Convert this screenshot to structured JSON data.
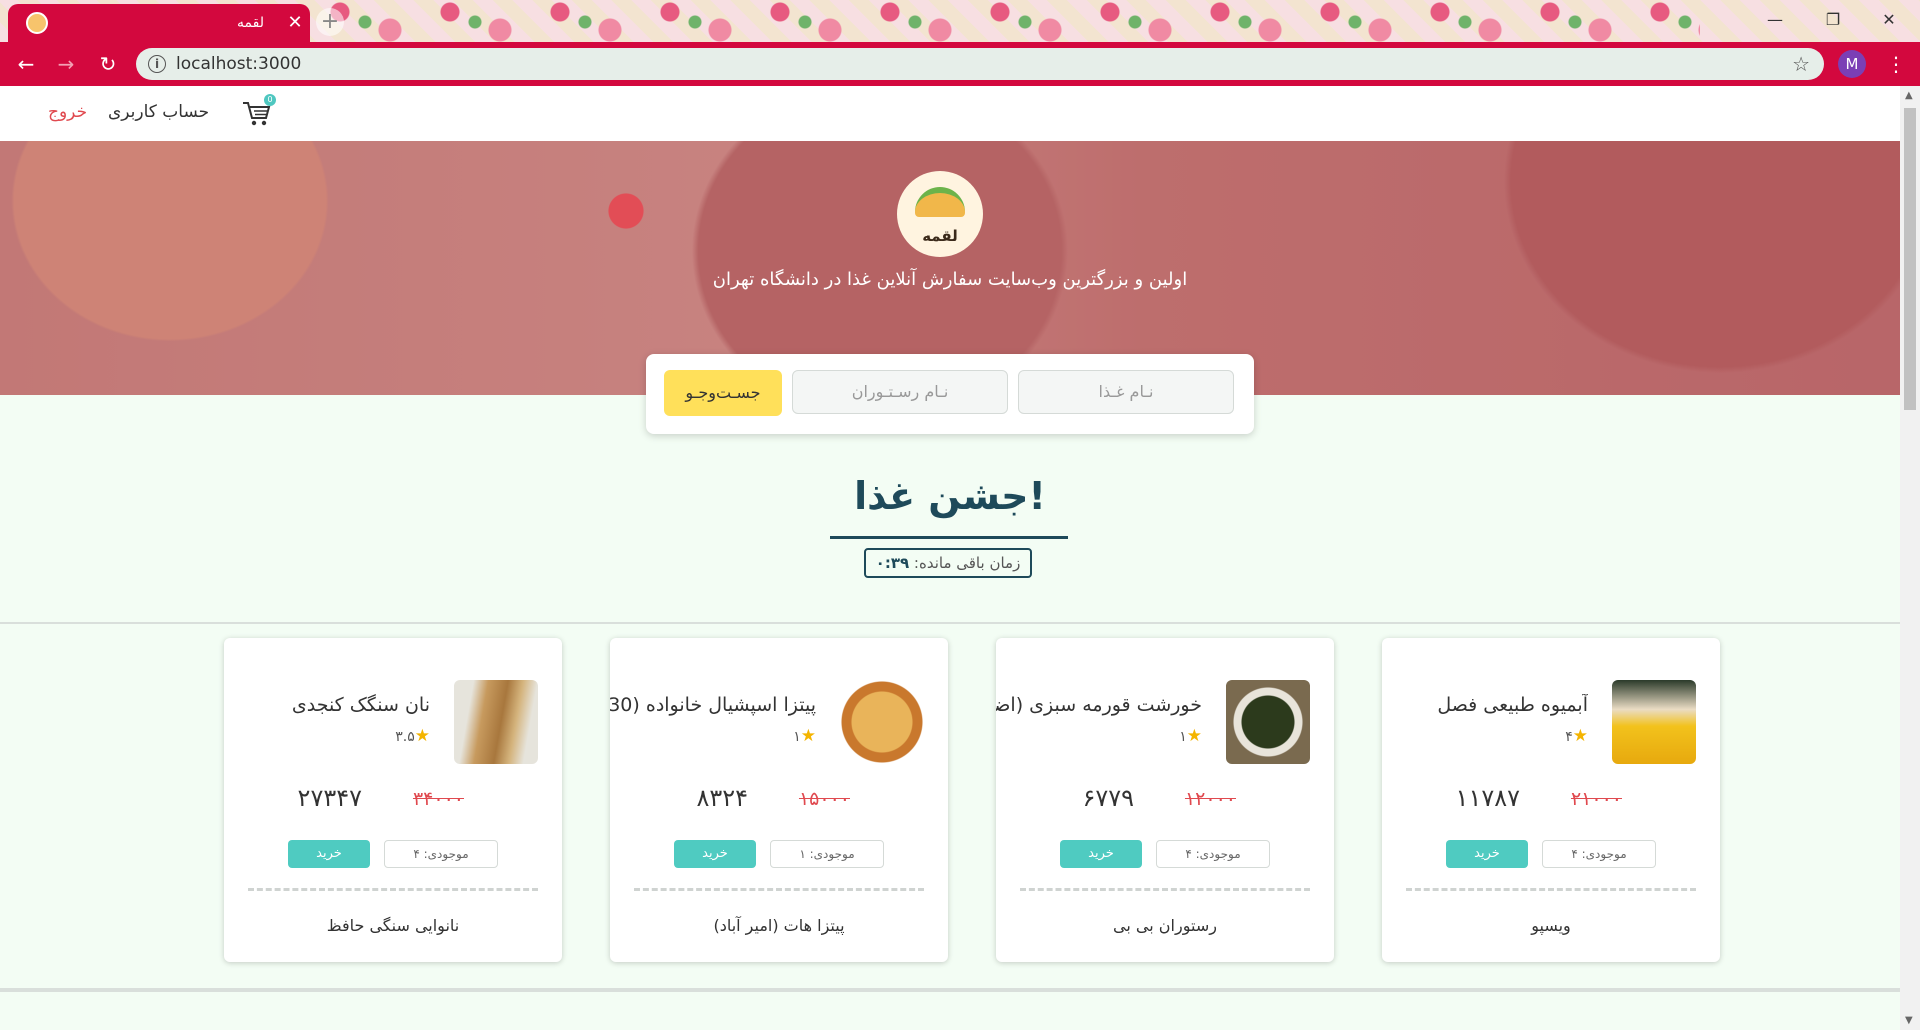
{
  "browser": {
    "tab_title": "لقمه",
    "url": "localhost:3000",
    "profile_initial": "M",
    "new_tab_label": "+",
    "close_label": "✕",
    "minimize_label": "—",
    "restore_label": "❐",
    "window_close_label": "✕"
  },
  "nav": {
    "account": "حساب کاربری",
    "logout": "خروج",
    "cart_count": "0"
  },
  "hero": {
    "logo_text": "لقمه",
    "tagline": "اولین و بزرگترین وب‌سایت سفارش آنلاین غذا در دانشگاه تهران"
  },
  "search": {
    "food_placeholder": "نـام غـذا",
    "restaurant_placeholder": "نـام رسـتـوران",
    "button": "جسـت‌وجـو"
  },
  "festival": {
    "title": "جشن غذا!",
    "timer_label": "زمان باقی مانده:",
    "timer_value": "۰:۳۹"
  },
  "cards": [
    {
      "name": "آبمیوه طبیعی فصل",
      "rating": "۴",
      "old_price": "۲۱۰۰۰",
      "new_price": "۱۱۷۸۷",
      "stock": "موجودی: ۴",
      "buy": "خرید",
      "restaurant": "ویسپو",
      "image": "juice-bottle"
    },
    {
      "name": "خورشت قورمه سبزی (اضافه",
      "rating": "۱",
      "old_price": "۱۲۰۰۰",
      "new_price": "۶۷۷۹",
      "stock": "موجودی: ۴",
      "buy": "خرید",
      "restaurant": "رستوران بی بی",
      "image": "stew-bowl"
    },
    {
      "name": "پیتزا اسپشیال خانواده (30",
      "rating": "۱",
      "old_price": "۱۵۰۰۰",
      "new_price": "۸۳۲۴",
      "stock": "موجودی: ۱",
      "buy": "خرید",
      "restaurant": "پیتزا هات (امیر آباد)",
      "image": "pizza"
    },
    {
      "name": "نان سنگک کنجدی",
      "rating": "۳.۵",
      "old_price": "۳۴۰۰۰",
      "new_price": "۲۷۳۴۷",
      "stock": "موجودی: ۴",
      "buy": "خرید",
      "restaurant": "نانوایی سنگی حافظ",
      "image": "sangak-bread"
    }
  ],
  "colors": {
    "chrome": "#d3083e",
    "accent_teal": "#4fcbc1",
    "search_button": "#ffe05a",
    "title": "#1e4a5a",
    "old_price": "#e0494f"
  }
}
